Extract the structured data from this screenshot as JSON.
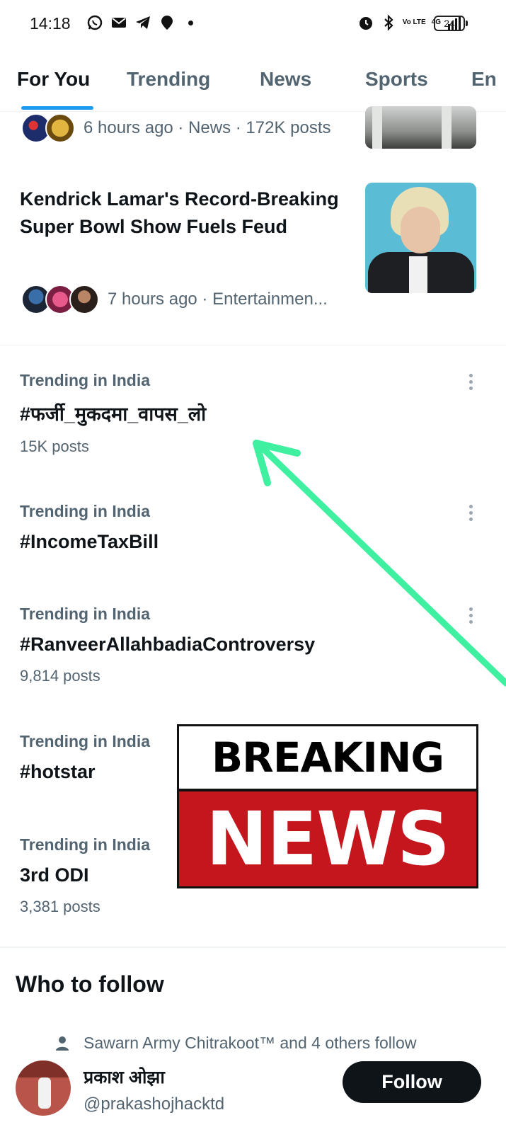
{
  "status_bar": {
    "time": "14:18",
    "network": "4G",
    "volte": "Vo LTE",
    "battery": "24",
    "icons": [
      "whatsapp-icon",
      "mail-icon",
      "telegram-icon",
      "location-icon",
      "dot-icon",
      "alarm-icon",
      "bluetooth-icon",
      "signal-icon"
    ]
  },
  "tabs": [
    {
      "label": "For You",
      "active": true
    },
    {
      "label": "Trending",
      "active": false
    },
    {
      "label": "News",
      "active": false
    },
    {
      "label": "Sports",
      "active": false
    },
    {
      "label": "En",
      "active": false
    }
  ],
  "news": [
    {
      "meta": "6 hours ago · News · 172K posts"
    },
    {
      "title": "Kendrick Lamar's Record-Breaking Super Bowl Show Fuels Feud",
      "meta": "7 hours ago · Entertainmen..."
    }
  ],
  "trends": [
    {
      "context": "Trending in India",
      "name": "#फर्जी_मुकदमा_वापस_लो",
      "count": "15K posts"
    },
    {
      "context": "Trending in India",
      "name": "#IncomeTaxBill",
      "count": ""
    },
    {
      "context": "Trending in India",
      "name": "#RanveerAllahbadiaControversy",
      "count": "9,814 posts"
    },
    {
      "context": "Trending in India",
      "name": "#hotstar",
      "count": ""
    },
    {
      "context": "Trending in India",
      "name": "3rd ODI",
      "count": "3,381 posts"
    }
  ],
  "overlay": {
    "breaking": "BREAKING",
    "news": "NEWS",
    "arrow_color": "#3ef0a0",
    "breaking_red": "#c4161c"
  },
  "who_to_follow": {
    "title": "Who to follow",
    "social_context": "Sawarn Army Chitrakoot™ and 4 others follow",
    "user_name": "प्रकाश ओझा",
    "user_handle": "@prakashojhacktd",
    "follow_label": "Follow"
  },
  "colors": {
    "accent": "#1d9bf0",
    "text_primary": "#0f1419",
    "text_secondary": "#536471"
  }
}
